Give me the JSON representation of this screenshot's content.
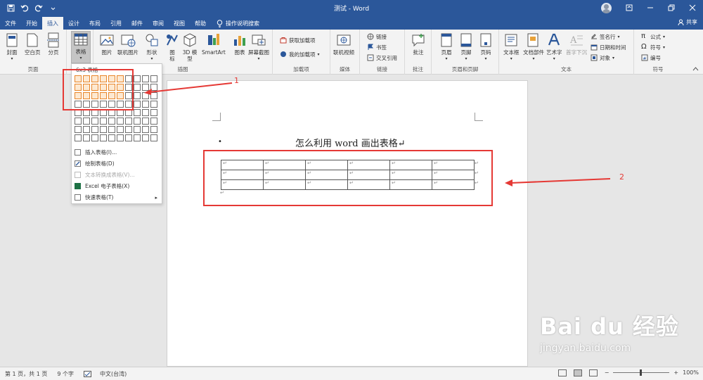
{
  "app": {
    "window_title": "测试 - Word",
    "share_label": "共享"
  },
  "tabs": [
    "文件",
    "开始",
    "插入",
    "设计",
    "布局",
    "引用",
    "邮件",
    "审阅",
    "视图",
    "帮助"
  ],
  "active_tab": "插入",
  "tell_me": "操作说明搜索",
  "ribbon": {
    "pages_group": {
      "label": "页面",
      "cover": "封面",
      "blank": "空白页",
      "break": "分页"
    },
    "tables_group": {
      "label": "表格",
      "table": "表格"
    },
    "illustrations_group": {
      "label": "插图",
      "picture": "图片",
      "online_picture": "联机图片",
      "shapes": "形状",
      "icons": "图标",
      "model3d": "3D 模型",
      "smartart": "SmartArt",
      "chart": "图表",
      "screenshot": "屏幕截图"
    },
    "addins_group": {
      "label": "加载项",
      "get": "获取加载项",
      "mine": "我的加载项"
    },
    "media_group": {
      "label": "媒体",
      "video": "联机视频"
    },
    "links_group": {
      "label": "链接",
      "link": "链接",
      "bookmark": "书签",
      "crossref": "交叉引用"
    },
    "comments_group": {
      "label": "批注",
      "comment": "批注"
    },
    "header_footer_group": {
      "label": "页眉和页脚",
      "header": "页眉",
      "footer": "页脚",
      "page_number": "页码"
    },
    "text_group": {
      "label": "文本",
      "textbox": "文本框",
      "quickparts": "文档部件",
      "wordart": "艺术字",
      "dropcap": "首字下沉",
      "signature": "签名行",
      "datetime": "日期和时间",
      "object": "对象"
    },
    "symbols_group": {
      "label": "符号",
      "equation": "公式",
      "symbol": "符号",
      "numbering": "编号"
    }
  },
  "table_dropdown": {
    "grid_label": "6x3 表格",
    "grid_cols": 10,
    "grid_rows": 8,
    "selected_cols": 6,
    "selected_rows": 3,
    "items": [
      {
        "label": "插入表格(I)...",
        "disabled": false
      },
      {
        "label": "绘制表格(D)",
        "disabled": false
      },
      {
        "label": "文本转换成表格(V)...",
        "disabled": true
      },
      {
        "label": "Excel 电子表格(X)",
        "disabled": false
      },
      {
        "label": "快速表格(T)",
        "disabled": false,
        "submenu": true
      }
    ]
  },
  "document": {
    "bullet": "•",
    "heading": "怎么利用 word 画出表格↵",
    "table_cols": 6,
    "table_rows": 3,
    "cell_mark": "↵",
    "row_end_mark": "↵",
    "after_mark": "↵"
  },
  "annotations": {
    "label_1": "1",
    "label_2": "2",
    "color": "#e53935"
  },
  "statusbar": {
    "page": "第 1 页，共 1 页",
    "words": "9 个字",
    "language": "中文(台湾)",
    "zoom": "100%",
    "zoom_minus": "−",
    "zoom_plus": "+"
  },
  "watermark": {
    "brand": "Bai du 经验",
    "url": "jingyan.baidu.com"
  },
  "colors": {
    "brand_blue": "#2b579a",
    "selection_orange": "#e8862a",
    "annotation_red": "#e53935"
  }
}
